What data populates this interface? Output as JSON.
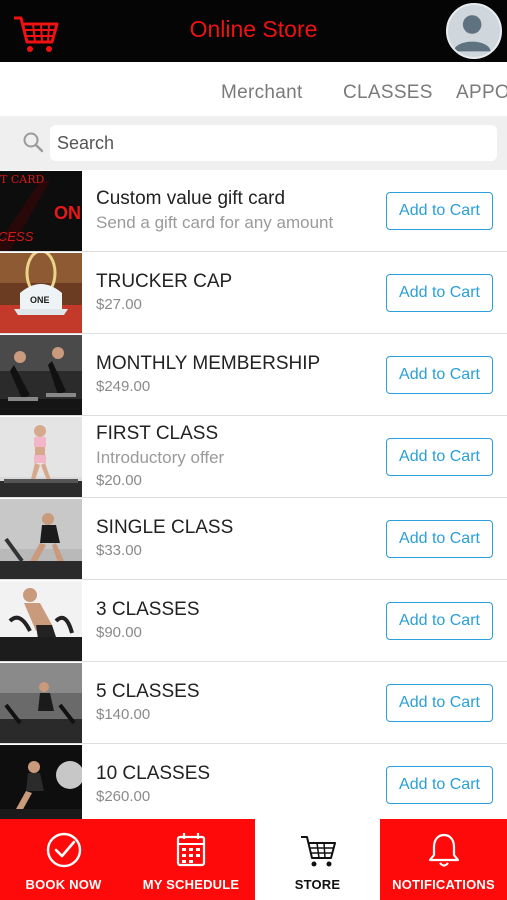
{
  "header": {
    "title": "Online Store",
    "cart_icon": "shopping-cart-icon",
    "avatar_icon": "user-avatar-icon"
  },
  "tabs": [
    "Merchant",
    "CLASSES",
    "APPO"
  ],
  "search": {
    "placeholder": "Search",
    "icon": "search-icon"
  },
  "products": [
    {
      "name": "Custom value gift card",
      "subtitle": "Send a gift card for any amount",
      "price": "",
      "button": "Add to Cart"
    },
    {
      "name": "TRUCKER CAP",
      "subtitle": "",
      "price": "$27.00",
      "button": "Add to Cart"
    },
    {
      "name": "MONTHLY MEMBERSHIP",
      "subtitle": "",
      "price": "$249.00",
      "button": "Add to Cart"
    },
    {
      "name": "FIRST CLASS",
      "subtitle": "Introductory offer",
      "price": "$20.00",
      "button": "Add to Cart"
    },
    {
      "name": "SINGLE CLASS",
      "subtitle": "",
      "price": "$33.00",
      "button": "Add to Cart"
    },
    {
      "name": "3 CLASSES",
      "subtitle": "",
      "price": "$90.00",
      "button": "Add to Cart"
    },
    {
      "name": "5 CLASSES",
      "subtitle": "",
      "price": "$140.00",
      "button": "Add to Cart"
    },
    {
      "name": "10 CLASSES",
      "subtitle": "",
      "price": "$260.00",
      "button": "Add to Cart"
    }
  ],
  "gift_card_thumb_text": {
    "top": "T CARD",
    "middle": "ON",
    "bottom": "CESS"
  },
  "cap_thumb_text": "ONE",
  "bottom_nav": [
    {
      "label": "BOOK NOW",
      "icon": "check-circle-icon",
      "active": false
    },
    {
      "label": "MY SCHEDULE",
      "icon": "calendar-icon",
      "active": false
    },
    {
      "label": "STORE",
      "icon": "shopping-cart-icon",
      "active": true
    },
    {
      "label": "NOTIFICATIONS",
      "icon": "bell-icon",
      "active": false
    }
  ],
  "colors": {
    "brand_red": "#ff0a0a",
    "header_bg": "#050505",
    "title_red": "#f01212",
    "button_blue": "#2a9fd8"
  }
}
